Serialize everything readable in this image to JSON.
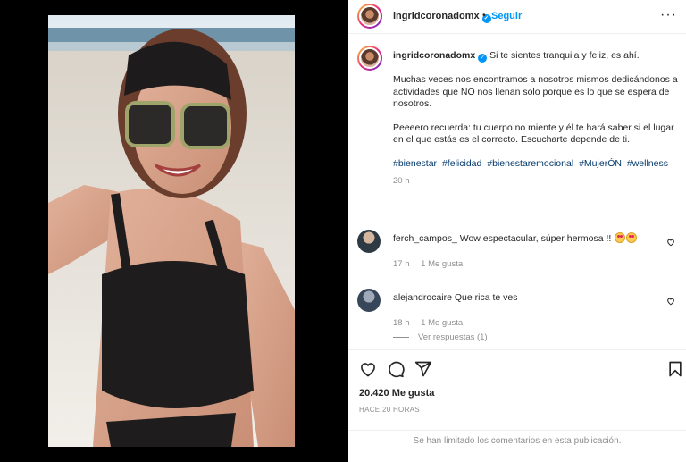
{
  "post": {
    "username": "ingridcoronadomx",
    "follow_label": "Seguir",
    "separator": "•",
    "more_icon": "more-horizontal-icon"
  },
  "caption": {
    "username": "ingridcoronadomx",
    "first_line": "Si te sientes tranquila y feliz, es ahí.",
    "paragraph2": "Muchas veces nos encontramos a nosotros mismos dedicándonos a actividades que NO nos llenan solo porque es lo que se espera de nosotros.",
    "paragraph3": "Peeeero recuerda: tu cuerpo no miente y él te hará saber si el lugar en el que estás es el correcto. Escucharte depende de ti.",
    "hashtags": [
      "#bienestar",
      "#felicidad",
      "#bienestaremocional",
      "#MujerÓN",
      "#wellness"
    ],
    "time": "20 h"
  },
  "comments": [
    {
      "username": "ferch_campos_",
      "text": "Wow espectacular, súper hermosa !!",
      "time": "17 h",
      "likes": "1 Me gusta"
    },
    {
      "username": "alejandrocaire",
      "text": "Que rica te ves",
      "time": "18 h",
      "likes": "1 Me gusta"
    }
  ],
  "replies_label": "Ver respuestas (1)",
  "actions": {
    "icons": [
      "heart-icon",
      "comment-icon",
      "share-icon",
      "bookmark-icon"
    ],
    "likes": "20.420 Me gusta",
    "timestamp": "HACE 20 HORAS"
  },
  "comments_limited": "Se han limitado los comentarios en esta publicación.",
  "colors": {
    "accent": "#0095f6",
    "hashtag": "#00376b",
    "muted": "#8e8e8e"
  }
}
